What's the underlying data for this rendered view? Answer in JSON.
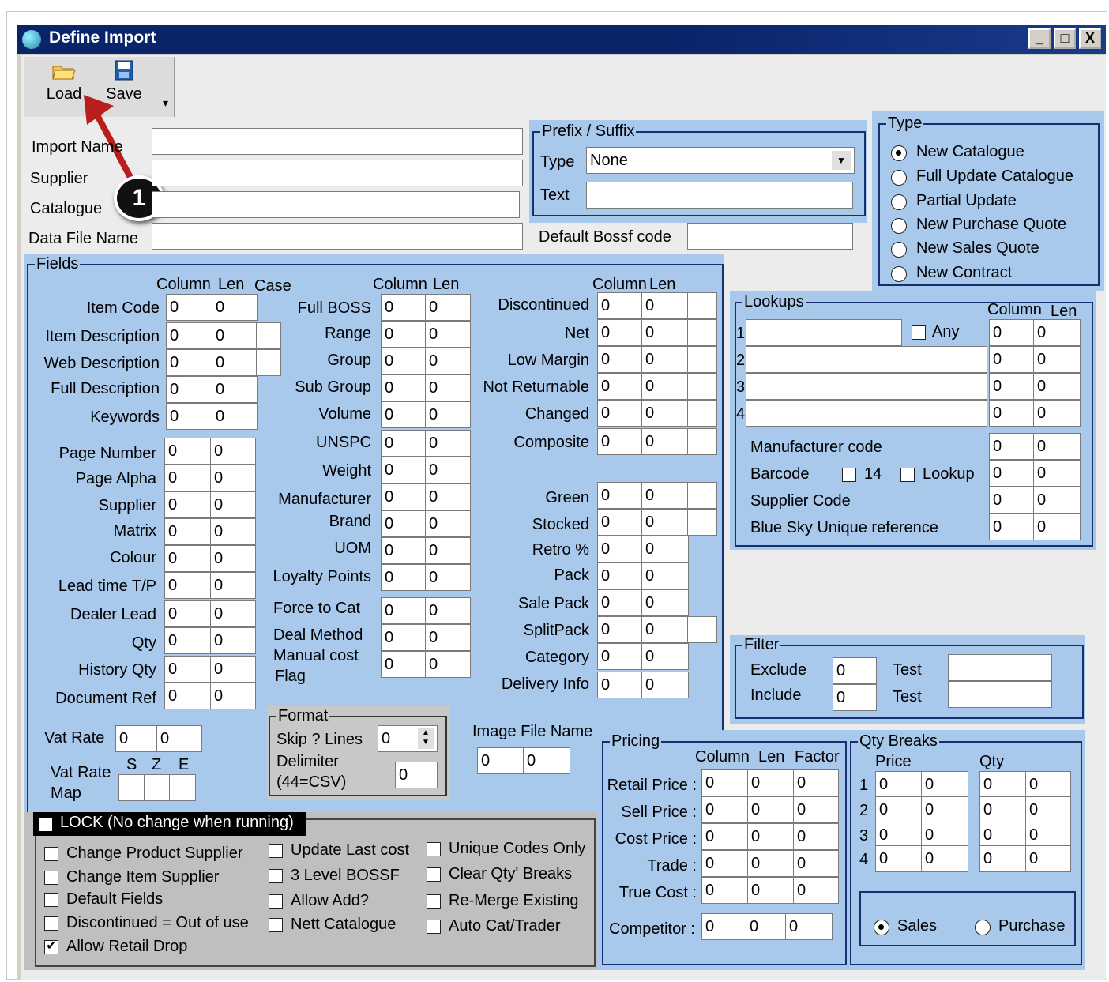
{
  "window": {
    "title": "Define Import",
    "min": "_",
    "max": "□",
    "close": "X"
  },
  "toolbar": {
    "load": "Load",
    "save": "Save",
    "more": "▾"
  },
  "callout": "1",
  "header": {
    "import_name": "Import Name",
    "supplier": "Supplier",
    "catalogue": "Catalogue",
    "data_file_name": "Data File Name",
    "default_bossf": "Default Bossf code"
  },
  "prefix": {
    "legend": "Prefix / Suffix",
    "type_label": "Type",
    "type_value": "None",
    "text_label": "Text"
  },
  "type": {
    "legend": "Type",
    "options": [
      "New Catalogue",
      "Full Update Catalogue",
      "Partial Update",
      "New Purchase Quote",
      "New Sales Quote",
      "New Contract"
    ]
  },
  "fields": {
    "legend": "Fields",
    "col": "Column",
    "len": "Len",
    "case": "Case",
    "left": [
      "Item Code",
      "Item Description",
      "Web Description",
      "Full  Description",
      "Keywords",
      "Page Number",
      "Page Alpha",
      "Supplier",
      "Matrix",
      "Colour",
      "Lead time T/P",
      "Dealer Lead",
      "Qty",
      "History Qty",
      "Document Ref"
    ],
    "mid": [
      "Full BOSS",
      "Range",
      "Group",
      "Sub Group",
      "Volume",
      "UNSPC",
      "Weight",
      "Manufacturer",
      "Brand",
      "UOM",
      "Loyalty Points",
      "Force to Cat",
      "Deal Method",
      "Manual cost",
      "Flag"
    ],
    "right": [
      "Discontinued",
      "Net",
      "Low Margin",
      "Not Returnable",
      "Changed",
      "Composite",
      "Green",
      "Stocked",
      "Retro %",
      "Pack",
      "Sale Pack",
      "SplitPack",
      "Category",
      "Delivery Info"
    ],
    "vat_rate": "Vat Rate",
    "vat_rate_map": "Vat Rate",
    "map": "Map",
    "s": "S",
    "z": "Z",
    "e": "E",
    "image_file": "Image File Name",
    "zero": "0"
  },
  "format": {
    "legend": "Format",
    "skip": "Skip ? Lines",
    "skip_val": "0",
    "delimiter": "Delimiter",
    "csv": "(44=CSV)",
    "delim_val": "0"
  },
  "lookups": {
    "legend": "Lookups",
    "col": "Column",
    "len": "Len",
    "any": "Any",
    "nums": [
      "1",
      "2",
      "3",
      "4"
    ],
    "rows": [
      "Manufacturer code",
      "Barcode",
      "Supplier Code",
      "Blue Sky Unique reference"
    ],
    "b14": "14",
    "lookup": "Lookup"
  },
  "filter": {
    "legend": "Filter",
    "exclude": "Exclude",
    "include": "Include",
    "test": "Test"
  },
  "pricing": {
    "legend": "Pricing",
    "col": "Column",
    "len": "Len",
    "factor": "Factor",
    "rows": [
      "Retail Price :",
      "Sell Price :",
      "Cost Price :",
      "Trade :",
      "True Cost :",
      "Competitor  :"
    ]
  },
  "qty": {
    "legend": "Qty Breaks",
    "price": "Price",
    "qty": "Qty",
    "nums": [
      "1",
      "2",
      "3",
      "4"
    ],
    "sales": "Sales",
    "purchase": "Purchase"
  },
  "lock": {
    "title": "LOCK (No change when running)",
    "c1": [
      "Change Product Supplier",
      "Change Item Supplier",
      "Default Fields",
      "Discontinued = Out of use",
      "Allow Retail Drop"
    ],
    "c2": [
      "Update Last cost",
      "3 Level BOSSF",
      "Allow Add?",
      "Nett Catalogue"
    ],
    "c3": [
      "Unique Codes Only",
      "Clear Qty' Breaks",
      "Re-Merge Existing",
      "Auto Cat/Trader"
    ]
  }
}
